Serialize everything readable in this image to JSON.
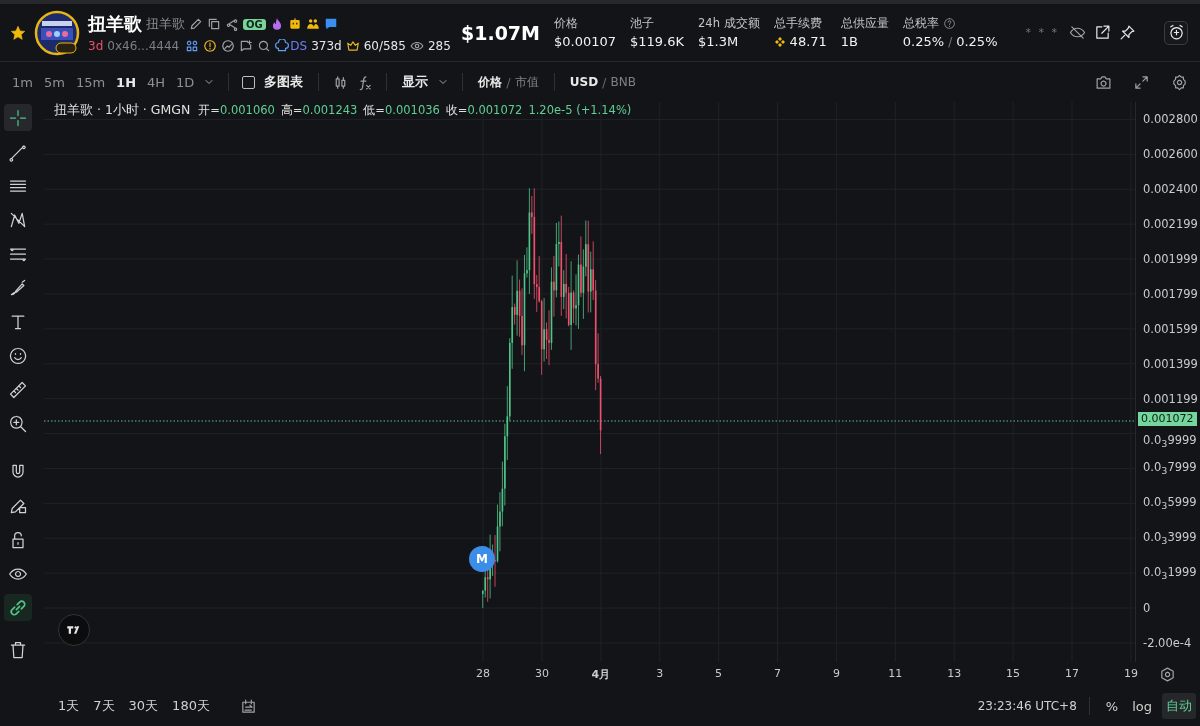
{
  "header": {
    "starred": true,
    "token_name": "扭羊歌",
    "token_alias": "扭羊歌",
    "og_badge": "OG",
    "age": "3d",
    "address": "0x46...4444",
    "ds_label": "DS",
    "ds_age": "373d",
    "holders": "60/585",
    "views": "285",
    "market_cap": "$1.07M",
    "masked": "* * *",
    "stats": [
      {
        "kind": "plain",
        "label": "价格",
        "value": "$0.00107"
      },
      {
        "kind": "plain",
        "label": "池子",
        "value": "$119.6K"
      },
      {
        "kind": "plain",
        "label": "24h 成交额",
        "value": "$1.3M"
      },
      {
        "kind": "bnb",
        "label": "总手续费",
        "value": "48.71"
      },
      {
        "kind": "plain",
        "label": "总供应量",
        "value": "1B"
      },
      {
        "kind": "tax",
        "label": "总税率",
        "value": "0.25%",
        "separator": "/",
        "value2": "0.25%"
      }
    ]
  },
  "toolbar": {
    "intervals": [
      {
        "label": "1m",
        "selected": false
      },
      {
        "label": "5m",
        "selected": false
      },
      {
        "label": "15m",
        "selected": false
      },
      {
        "label": "1H",
        "selected": true
      },
      {
        "label": "4H",
        "selected": false
      },
      {
        "label": "1D",
        "selected": false
      }
    ],
    "multi_chart": {
      "label": "多图表",
      "checked": false
    },
    "display": "显示",
    "price_mode": {
      "separator": "/",
      "options": [
        {
          "label": "价格",
          "selected": true
        },
        {
          "label": "市值",
          "selected": false
        }
      ]
    },
    "currency": {
      "separator": "/",
      "options": [
        {
          "label": "USD",
          "selected": true
        },
        {
          "label": "BNB",
          "selected": false
        }
      ]
    }
  },
  "drawing_tools": [
    {
      "kind": "crosshair",
      "selected": true
    },
    {
      "kind": "line",
      "selected": false
    },
    {
      "kind": "hlines",
      "selected": false
    },
    {
      "kind": "pattern",
      "selected": false
    },
    {
      "kind": "fib",
      "selected": false
    },
    {
      "kind": "brush",
      "selected": false
    },
    {
      "kind": "text",
      "selected": false
    },
    {
      "kind": "emoji",
      "selected": false
    },
    {
      "kind": "ruler",
      "selected": false
    },
    {
      "kind": "zoom",
      "selected": false
    },
    {
      "kind": "magnet",
      "selected": false
    },
    {
      "kind": "pencil-lock",
      "selected": false
    },
    {
      "kind": "lock",
      "selected": false
    },
    {
      "kind": "eye",
      "selected": false
    },
    {
      "kind": "link",
      "selected": true
    },
    {
      "kind": "trash",
      "selected": false
    }
  ],
  "legend": {
    "title": "扭羊歌 · 1小时 · GMGN",
    "fields": [
      {
        "label": "开=",
        "value": "0.001060"
      },
      {
        "label": "高=",
        "value": "0.001243"
      },
      {
        "label": "低=",
        "value": "0.001036"
      },
      {
        "label": "收=",
        "value": "0.001072"
      }
    ],
    "change": "1.20e-5 (+1.14%)"
  },
  "y_axis": [
    "0.002800",
    "0.002600",
    "0.002400",
    "0.002199",
    "0.001999",
    "0.001799",
    "0.001599",
    "0.001399",
    "0.001199",
    "0.0$_{3}$9999",
    "0.0$_{3}$7999",
    "0.0$_{3}$5999",
    "0.0$_{3}$3999",
    "0.0$_{3}$1999",
    "0",
    "-2.00e-4"
  ],
  "last_price": "0.001072",
  "marker": "M",
  "x_axis": [
    {
      "label": "28",
      "kind": "day"
    },
    {
      "label": "30",
      "kind": "day"
    },
    {
      "label": "4月",
      "kind": "month"
    },
    {
      "label": "3",
      "kind": "day"
    },
    {
      "label": "5",
      "kind": "day"
    },
    {
      "label": "7",
      "kind": "day"
    },
    {
      "label": "9",
      "kind": "day"
    },
    {
      "label": "11",
      "kind": "day"
    },
    {
      "label": "13",
      "kind": "day"
    },
    {
      "label": "15",
      "kind": "day"
    },
    {
      "label": "17",
      "kind": "day"
    },
    {
      "label": "19",
      "kind": "day"
    }
  ],
  "footer": {
    "ranges": [
      "1天",
      "7天",
      "30天",
      "180天"
    ],
    "time": "23:23:46 UTC+8",
    "percent": "%",
    "log": {
      "label": "log",
      "on": false
    },
    "auto": {
      "label": "自动",
      "on": true
    }
  }
}
